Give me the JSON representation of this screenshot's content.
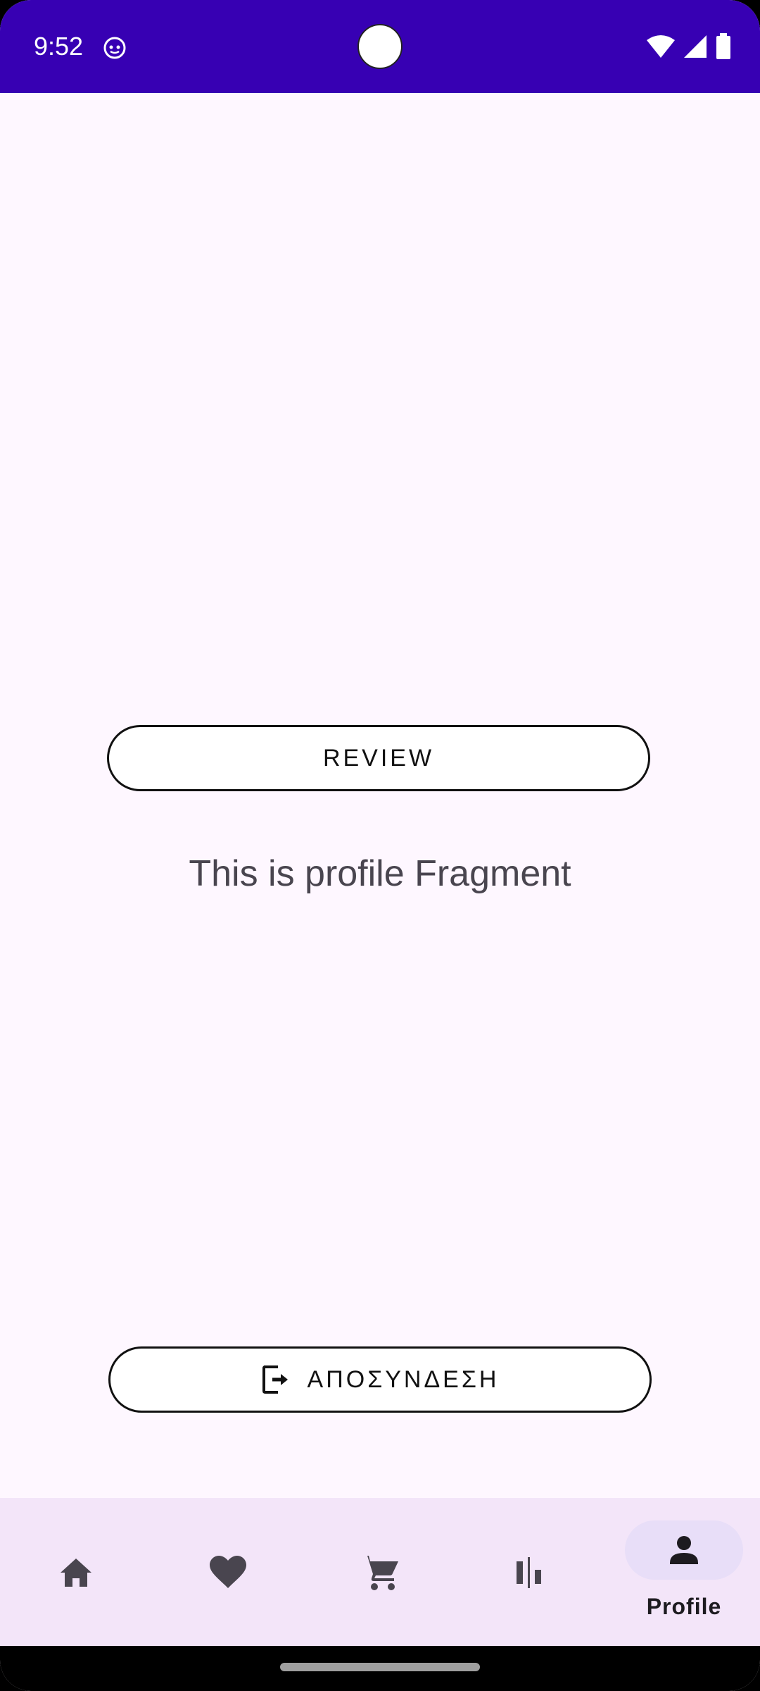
{
  "status_bar": {
    "time": "9:52",
    "background": "#3700B3",
    "icons": [
      "app-notification-icon",
      "wifi-icon",
      "cell-signal-icon",
      "battery-icon"
    ]
  },
  "main": {
    "review_button": "REVIEW",
    "fragment_text": "This is profile Fragment",
    "logout_button": "ΑΠΟΣΥΝΔΕΣΗ",
    "logout_icon": "logout-icon"
  },
  "bottom_nav": {
    "items": [
      {
        "icon": "home-icon",
        "label": ""
      },
      {
        "icon": "heart-icon",
        "label": ""
      },
      {
        "icon": "cart-icon",
        "label": ""
      },
      {
        "icon": "compare-icon",
        "label": ""
      },
      {
        "icon": "person-icon",
        "label": "Profile",
        "active": true
      }
    ],
    "active_indicator_color": "#E8DEF8",
    "background": "#F3E5F9"
  }
}
